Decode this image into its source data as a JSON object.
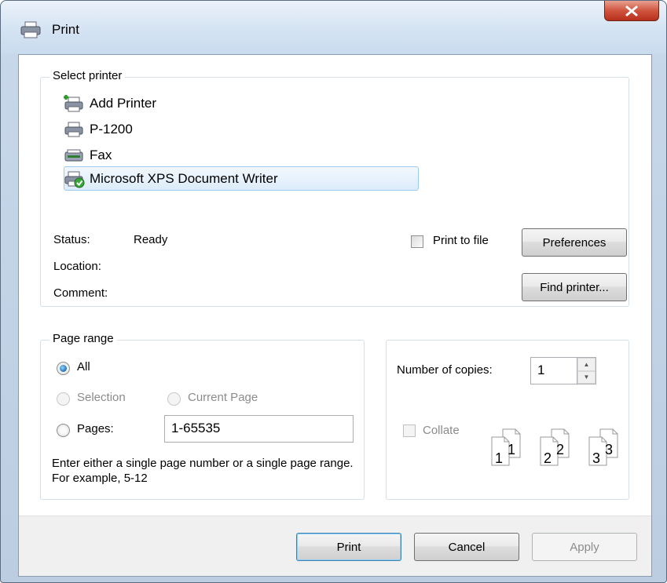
{
  "window": {
    "title": "Print",
    "close_label": "X"
  },
  "select_printer": {
    "group_label": "Select printer",
    "printers": [
      {
        "name": "Add Printer",
        "icon": "add-printer-icon"
      },
      {
        "name": "P-1200",
        "icon": "printer-icon"
      },
      {
        "name": "Fax",
        "icon": "fax-icon"
      },
      {
        "name": "Microsoft XPS Document Writer",
        "icon": "xps-printer-icon",
        "selected": true
      }
    ],
    "status_label": "Status:",
    "status_value": "Ready",
    "location_label": "Location:",
    "comment_label": "Comment:",
    "print_to_file_label": "Print to file",
    "preferences_label": "Preferences",
    "find_printer_label": "Find printer..."
  },
  "page_range": {
    "group_label": "Page range",
    "all_label": "All",
    "selection_label": "Selection",
    "current_page_label": "Current Page",
    "pages_label": "Pages:",
    "pages_value": "1-65535",
    "hint": "Enter either a single page number or a single page range.  For example, 5-12"
  },
  "copies": {
    "number_label": "Number of copies:",
    "number_value": "1",
    "collate_label": "Collate",
    "collate_pages": [
      "1",
      "1",
      "2",
      "2",
      "3",
      "3"
    ]
  },
  "buttons": {
    "print": "Print",
    "cancel": "Cancel",
    "apply": "Apply"
  }
}
